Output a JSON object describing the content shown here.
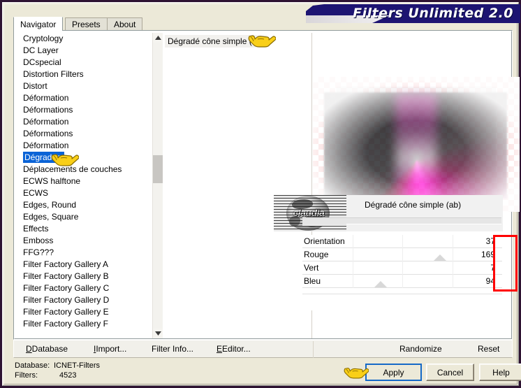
{
  "window": {
    "title": "Filters Unlimited 2.0",
    "accent_navy": "#1d1472",
    "annotation_red": "#ff0000"
  },
  "tabs": [
    {
      "label": "Navigator",
      "active": true
    },
    {
      "label": "Presets",
      "active": false
    },
    {
      "label": "About",
      "active": false
    }
  ],
  "filter_list": {
    "selected": "Dégradés",
    "items": [
      "Cryptology",
      "DC Layer",
      "DCspecial",
      "Distortion Filters",
      "Distort",
      "Déformation",
      "Déformations",
      "Déformation",
      "Déformations",
      "Déformation",
      "Dégradés",
      "Déplacements de couches",
      "ECWS halftone",
      "ECWS",
      "Edges, Round",
      "Edges, Square",
      "Effects",
      "Emboss",
      "FFG???",
      "Filter Factory Gallery A",
      "Filter Factory Gallery B",
      "Filter Factory Gallery C",
      "Filter Factory Gallery D",
      "Filter Factory Gallery E",
      "Filter Factory Gallery F"
    ]
  },
  "selected_filter": {
    "name": "Dégradé cône simple (ab)",
    "preset_title": "Dégradé cône simple (ab)"
  },
  "watermark": {
    "text": "claudia"
  },
  "sliders": [
    {
      "label": "Orientation",
      "value": "37",
      "pos_pct": 0
    },
    {
      "label": "Rouge",
      "value": "169",
      "pos_pct": 69
    },
    {
      "label": "Vert",
      "value": "7",
      "pos_pct": 0
    },
    {
      "label": "Bleu",
      "value": "94",
      "pos_pct": 39
    }
  ],
  "action_links": [
    {
      "label": "Database",
      "accel": "D"
    },
    {
      "label": "Import...",
      "accel": "I"
    },
    {
      "label": "Filter Info...",
      "accel": "I"
    },
    {
      "label": "Editor...",
      "accel": "E"
    },
    {
      "label": "Randomize",
      "accel": ""
    },
    {
      "label": "Reset",
      "accel": ""
    }
  ],
  "status": {
    "database_label": "Database:",
    "database_value": "ICNET-Filters",
    "filters_label": "Filters:",
    "filters_value": "4523"
  },
  "buttons": [
    {
      "label": "Apply",
      "focused": true
    },
    {
      "label": "Cancel",
      "focused": false
    },
    {
      "label": "Help",
      "focused": false
    }
  ]
}
